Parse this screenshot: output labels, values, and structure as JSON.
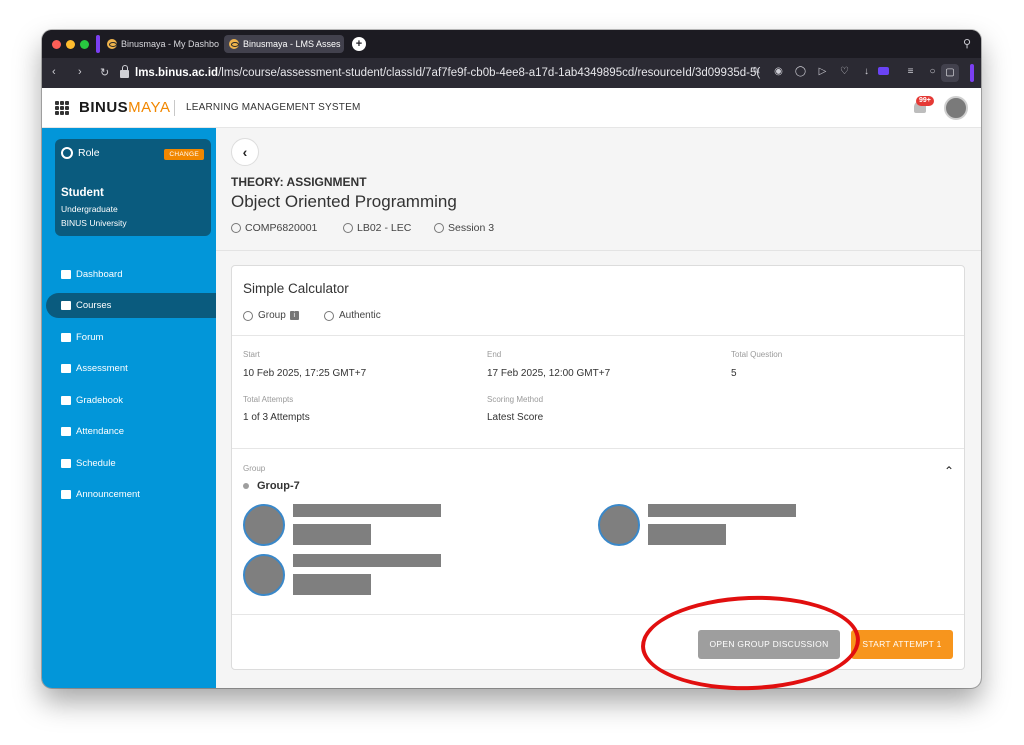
{
  "browser": {
    "tabs": [
      {
        "title": "Binusmaya - My Dashbo",
        "active": false
      },
      {
        "title": "Binusmaya - LMS Asses",
        "active": true
      }
    ],
    "new_tab_label": "+",
    "url_host": "lms.binus.ac.id",
    "url_path": "/lms/course/assessment-student/classId/7af7fe9f-cb0b-4ee8-a17d-1ab4349895cd/resourceId/3d09935d-5("
  },
  "header": {
    "logo_left": "BINUS",
    "logo_right": "MAYA",
    "title": "LEARNING MANAGEMENT SYSTEM",
    "notification_count": "99+"
  },
  "sidebar": {
    "role": {
      "label": "Role",
      "change_label": "CHANGE",
      "name": "Student",
      "line1": "Undergraduate",
      "line2": "BINUS University"
    },
    "items": [
      {
        "label": "Dashboard",
        "icon": "dashboard-icon",
        "active": false
      },
      {
        "label": "Courses",
        "icon": "courses-icon",
        "active": true
      },
      {
        "label": "Forum",
        "icon": "forum-icon",
        "active": false
      },
      {
        "label": "Assessment",
        "icon": "assessment-icon",
        "active": false
      },
      {
        "label": "Gradebook",
        "icon": "gradebook-icon",
        "active": false
      },
      {
        "label": "Attendance",
        "icon": "attendance-icon",
        "active": false
      },
      {
        "label": "Schedule",
        "icon": "schedule-icon",
        "active": false
      },
      {
        "label": "Announcement",
        "icon": "announcement-icon",
        "active": false
      }
    ]
  },
  "course": {
    "kind": "THEORY: ASSIGNMENT",
    "name": "Object Oriented Programming",
    "code": "COMP6820001",
    "class": "LB02 - LEC",
    "session": "Session 3"
  },
  "assignment": {
    "title": "Simple Calculator",
    "tags": [
      "Group",
      "Authentic"
    ],
    "fields": {
      "start_label": "Start",
      "start_value": "10 Feb 2025, 17:25 GMT+7",
      "end_label": "End",
      "end_value": "17 Feb 2025, 12:00 GMT+7",
      "total_question_label": "Total Question",
      "total_question_value": "5",
      "total_attempts_label": "Total Attempts",
      "total_attempts_value": "1 of 3 Attempts",
      "scoring_label": "Scoring Method",
      "scoring_value": "Latest Score"
    },
    "group_label": "Group",
    "group_name": "Group-7",
    "actions": {
      "open_group_discussion": "OPEN GROUP DISCUSSION",
      "start_attempt": "START ATTEMPT 1"
    }
  },
  "colors": {
    "sidebar": "#0296d9",
    "role_card": "#0a5b7e",
    "accent_orange": "#f7951d",
    "annotation_red": "#e10f0f"
  }
}
